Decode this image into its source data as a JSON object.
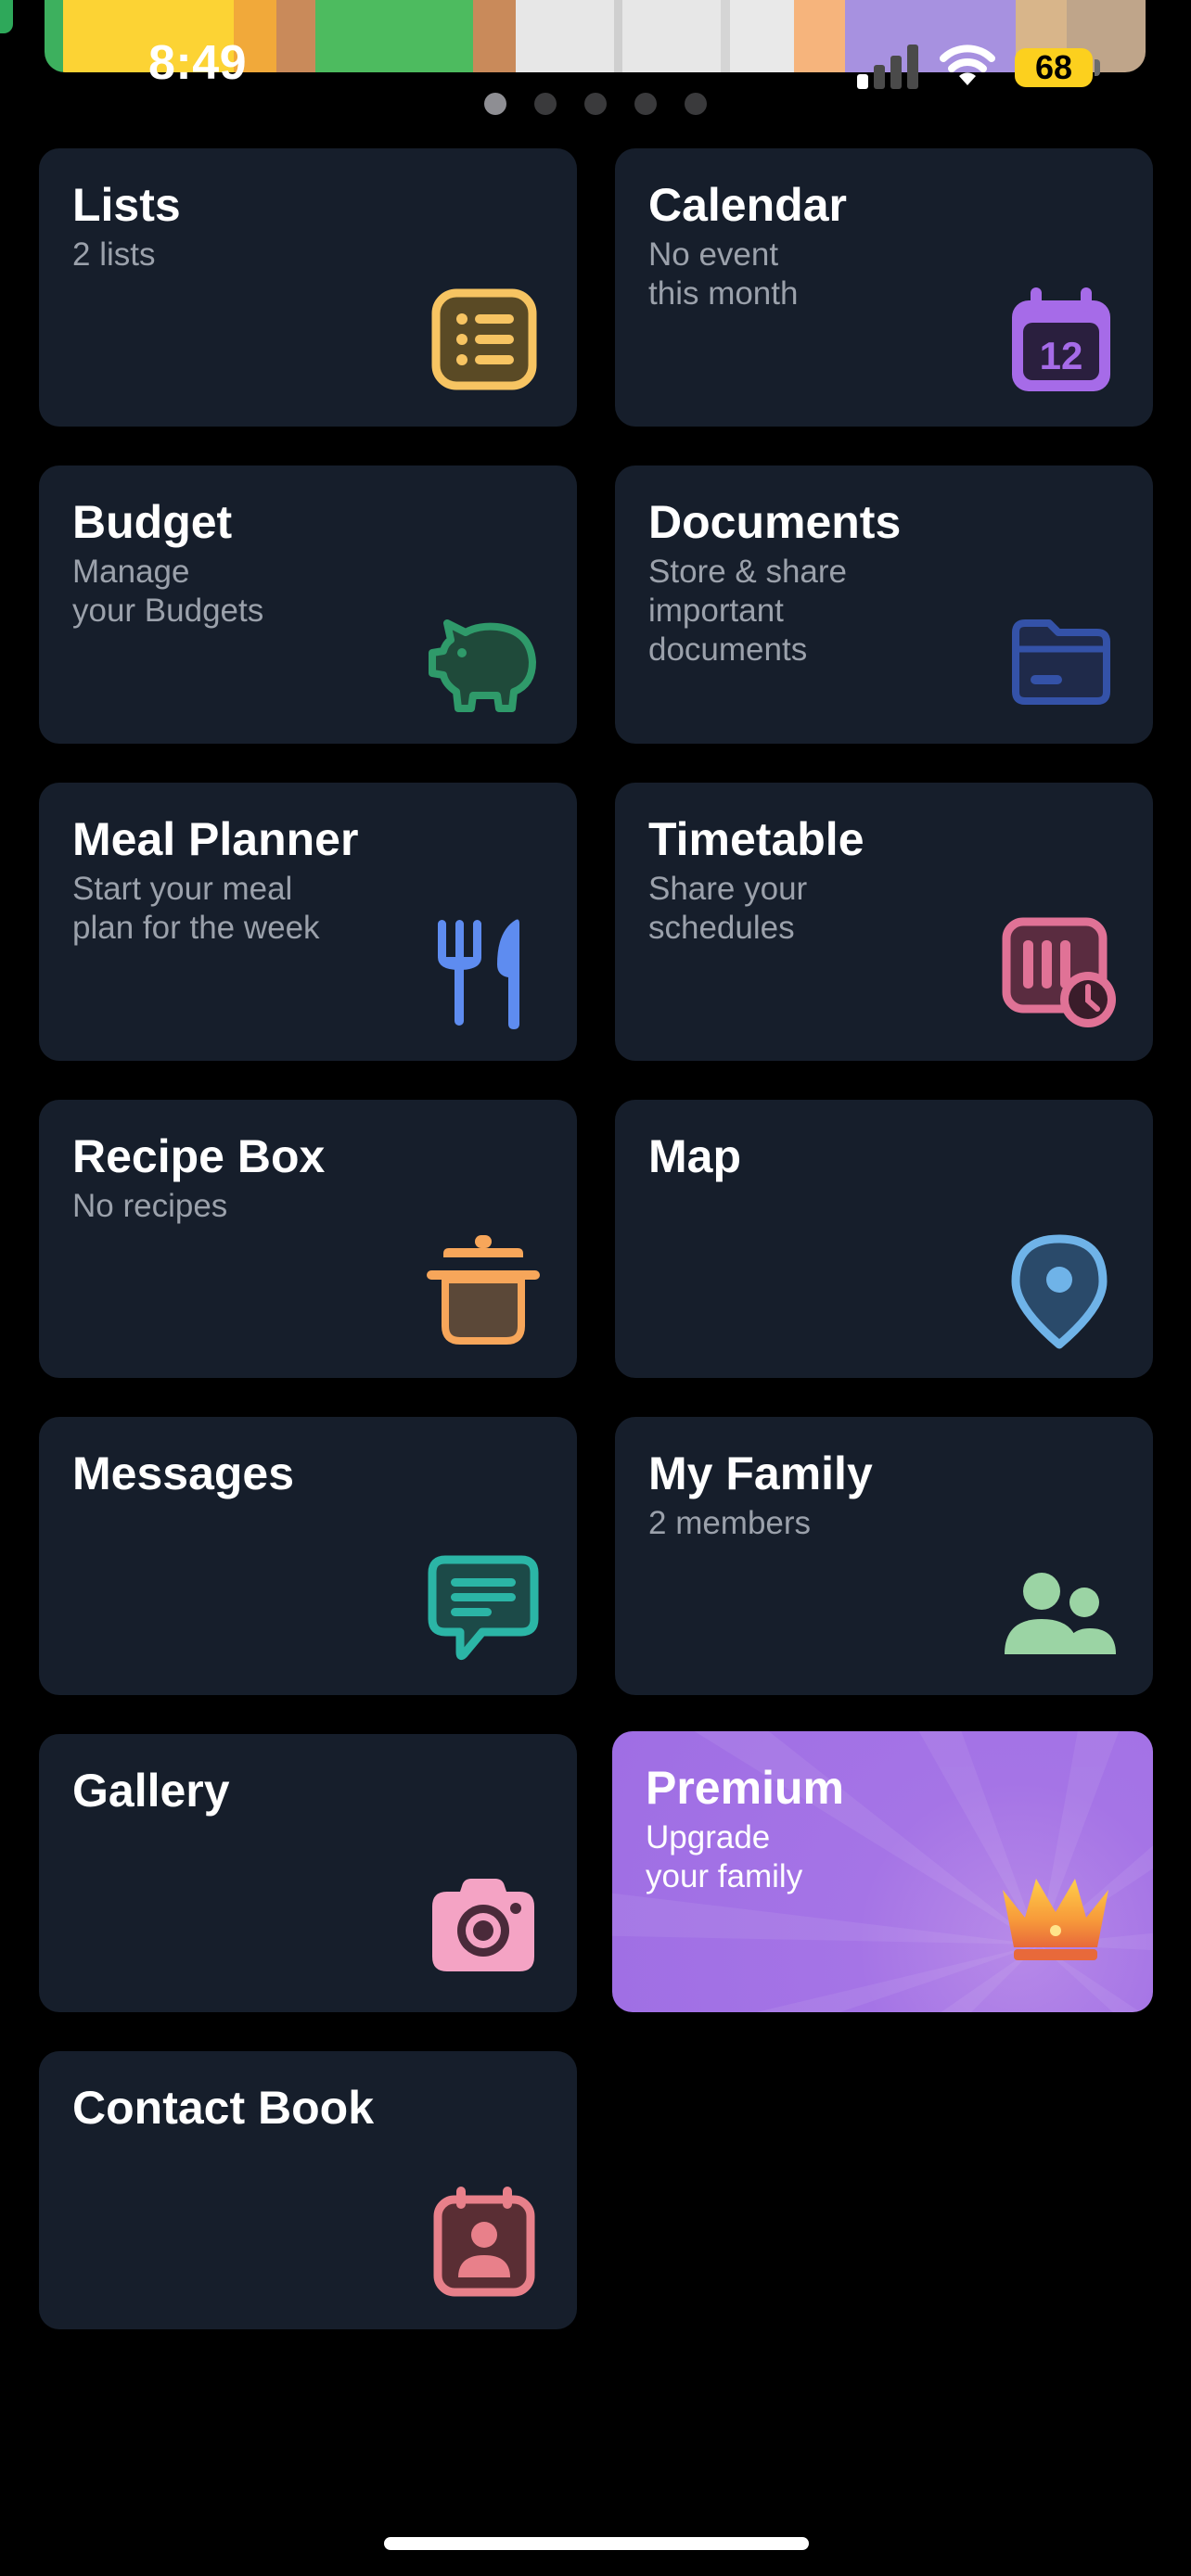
{
  "status_bar": {
    "time": "8:49",
    "battery": "68"
  },
  "page_dots": {
    "count": 5,
    "active_index": 0
  },
  "cards": [
    {
      "title": "Lists",
      "subtitle": "2 lists",
      "icon": "list-icon",
      "color": "#f7c462"
    },
    {
      "title": "Calendar",
      "subtitle": "No event\nthis month",
      "icon": "calendar-icon",
      "icon_text": "12",
      "color": "#a66be8"
    },
    {
      "title": "Budget",
      "subtitle": "Manage\nyour Budgets",
      "icon": "piggy-bank-icon",
      "color": "#2f9a6a"
    },
    {
      "title": "Documents",
      "subtitle": "Store & share\nimportant\ndocuments",
      "icon": "folder-icon",
      "color": "#3452a8"
    },
    {
      "title": "Meal Planner",
      "subtitle": "Start your meal\nplan for the week",
      "icon": "fork-knife-icon",
      "color": "#5e8cf0"
    },
    {
      "title": "Timetable",
      "subtitle": "Share your\nschedules",
      "icon": "timetable-clock-icon",
      "color": "#e07296"
    },
    {
      "title": "Recipe Box",
      "subtitle": "No recipes",
      "icon": "cooking-pot-icon",
      "color": "#f7a65a"
    },
    {
      "title": "Map",
      "subtitle": "",
      "icon": "map-pin-icon",
      "color": "#6fb3e8"
    },
    {
      "title": "Messages",
      "subtitle": "",
      "icon": "chat-icon",
      "color": "#2bb5a6"
    },
    {
      "title": "My Family",
      "subtitle": "2 members",
      "icon": "people-icon",
      "color": "#9bd4a4"
    },
    {
      "title": "Gallery",
      "subtitle": "",
      "icon": "camera-icon",
      "color": "#f4a3c4"
    },
    {
      "title": "Premium",
      "subtitle": "Upgrade\nyour family",
      "icon": "crown-icon",
      "color": "#a574e6"
    },
    {
      "title": "Contact Book",
      "subtitle": "",
      "icon": "contact-card-icon",
      "color": "#e8808a"
    }
  ]
}
